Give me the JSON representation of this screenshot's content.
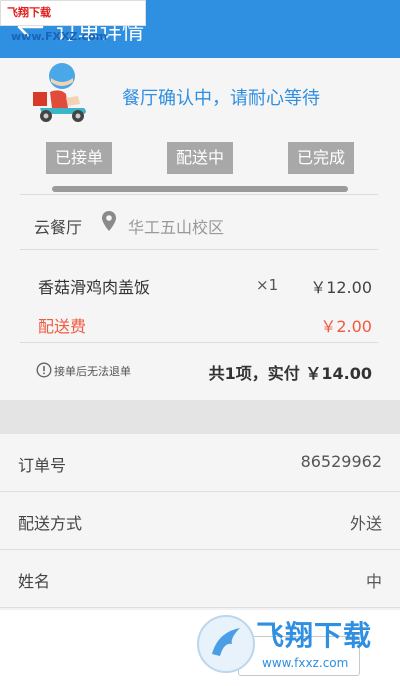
{
  "header": {
    "title": "订单详情"
  },
  "watermark": {
    "brand": "飞翔下载",
    "url": "www.FXXZ.com"
  },
  "status": {
    "message": "餐厅确认中，请耐心等待",
    "steps": [
      {
        "label": "已接单"
      },
      {
        "label": "配送中"
      },
      {
        "label": "已完成"
      }
    ]
  },
  "order": {
    "restaurant": "云餐厅",
    "address": "华工五山校区",
    "items": [
      {
        "name": "香菇滑鸡肉盖饭",
        "qty": "×1",
        "price": "￥12.00"
      }
    ],
    "fee": {
      "name": "配送费",
      "price": "￥2.00"
    },
    "notice": "接单后无法退单",
    "summary": "共1项，实付 ￥14.00"
  },
  "info": {
    "rows": [
      {
        "label": "订单号",
        "value": "86529962"
      },
      {
        "label": "配送方式",
        "value": "外送"
      },
      {
        "label": "姓名",
        "value": "中"
      }
    ]
  },
  "footer": {
    "logo_text": "飞翔下载",
    "logo_url": "www.fxxz.com"
  },
  "colors": {
    "primary": "#2f8fe0",
    "fee": "#f05a40",
    "step_bg": "#a8a8a8"
  }
}
